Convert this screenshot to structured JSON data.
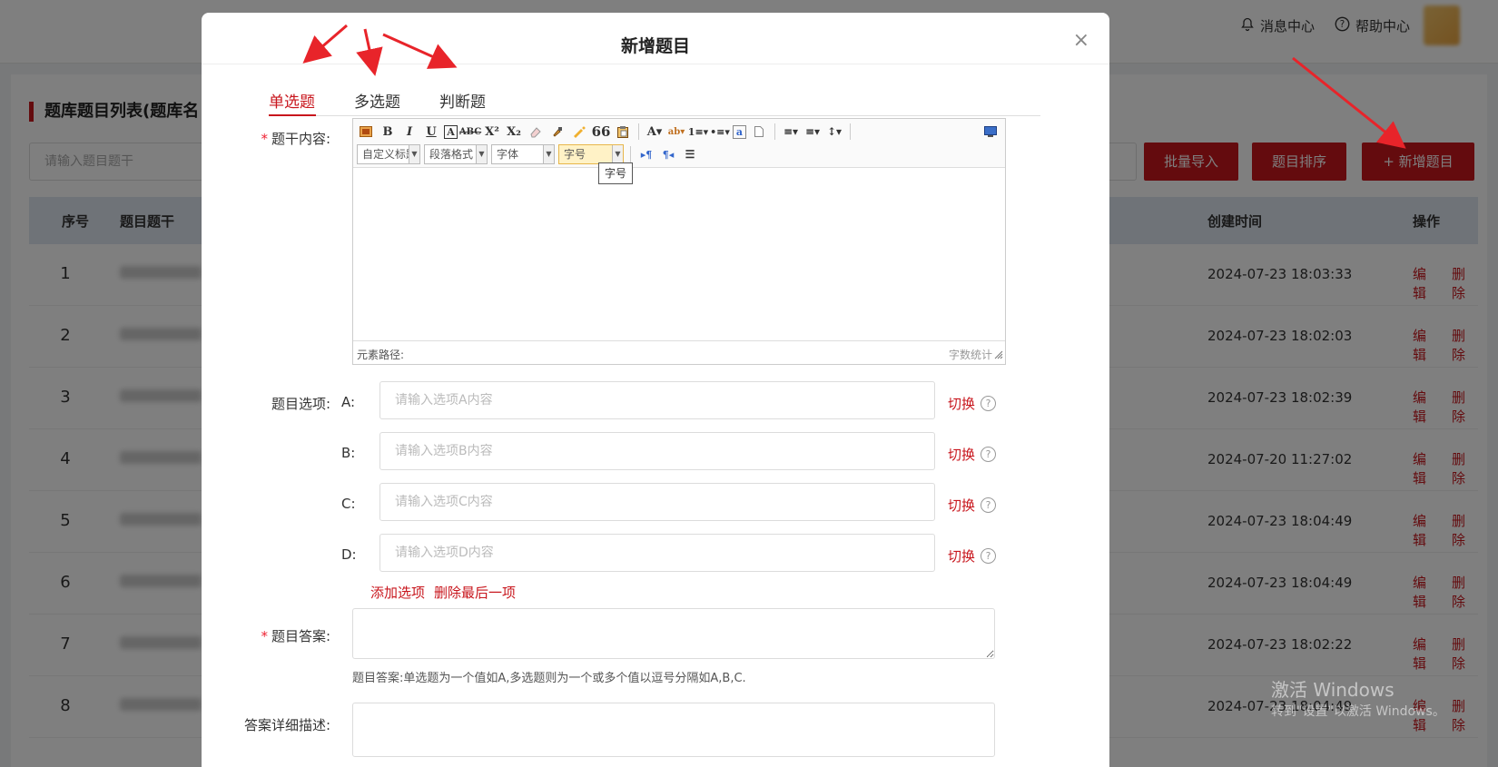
{
  "header": {
    "message_center": "消息中心",
    "help_center": "帮助中心"
  },
  "list": {
    "title": "题库题目列表(题库名",
    "search_placeholder": "请输入题目题干",
    "buttons": {
      "batch_import": "批量导入",
      "sort": "题目排序",
      "add": "+ 新增题目"
    },
    "columns": {
      "no": "序号",
      "stem": "题目题干",
      "created": "创建时间",
      "ops": "操作"
    },
    "rows": [
      {
        "no": "1",
        "time": "2024-07-23 18:03:33",
        "edit": "编辑",
        "del": "删除"
      },
      {
        "no": "2",
        "time": "2024-07-23 18:02:03",
        "edit": "编辑",
        "del": "删除"
      },
      {
        "no": "3",
        "time": "2024-07-23 18:02:39",
        "edit": "编辑",
        "del": "删除"
      },
      {
        "no": "4",
        "time": "2024-07-20 11:27:02",
        "edit": "编辑",
        "del": "删除"
      },
      {
        "no": "5",
        "time": "2024-07-23 18:04:49",
        "edit": "编辑",
        "del": "删除"
      },
      {
        "no": "6",
        "time": "2024-07-23 18:04:49",
        "edit": "编辑",
        "del": "删除"
      },
      {
        "no": "7",
        "time": "2024-07-23 18:02:22",
        "edit": "编辑",
        "del": "删除"
      },
      {
        "no": "8",
        "time": "2024-07-23 18:04:49",
        "edit": "编辑",
        "del": "删除"
      }
    ]
  },
  "modal": {
    "title": "新增题目",
    "close": "×",
    "tabs": [
      "单选题",
      "多选题",
      "判断题"
    ],
    "stem_label": "题干内容:",
    "required_mark": "*",
    "editor": {
      "sel_custom": "自定义标题",
      "sel_para": "段落格式",
      "sel_font": "字体",
      "sel_size": "字号",
      "tooltip": "字号",
      "path_label": "元素路径:",
      "word_count": "字数统计"
    },
    "options_label": "题目选项:",
    "options": [
      {
        "letter": "A:",
        "placeholder": "请输入选项A内容"
      },
      {
        "letter": "B:",
        "placeholder": "请输入选项B内容"
      },
      {
        "letter": "C:",
        "placeholder": "请输入选项C内容"
      },
      {
        "letter": "D:",
        "placeholder": "请输入选项D内容"
      }
    ],
    "switch_label": "切换",
    "help_glyph": "?",
    "add_option": "添加选项",
    "remove_last": "删除最后一项",
    "answer_label": "题目答案:",
    "answer_hint": "题目答案:单选题为一个值如A,多选题则为一个或多个值以逗号分隔如A,B,C.",
    "desc_label": "答案详细描述:"
  },
  "watermark": {
    "line1": "激活 Windows",
    "line2": "转到\"设置\"以激活 Windows。"
  },
  "colors": {
    "accent": "#c8161d",
    "arrow": "#e8242a"
  }
}
